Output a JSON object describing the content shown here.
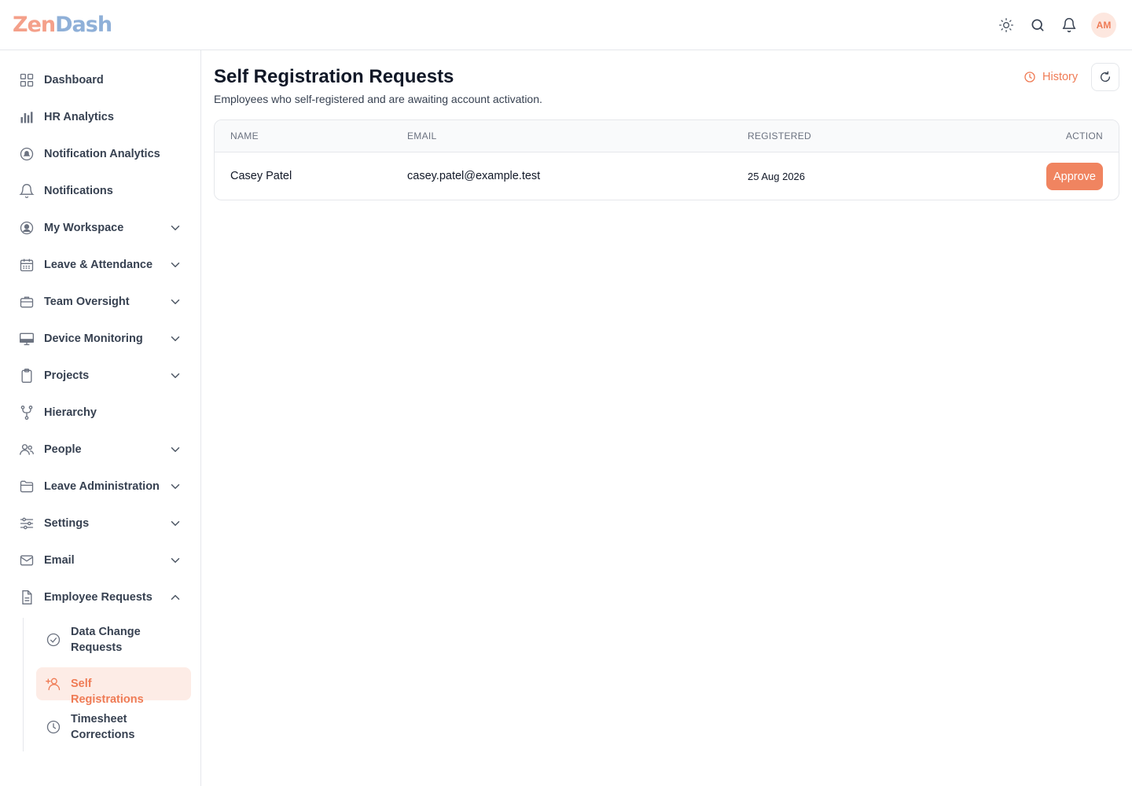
{
  "brand": {
    "logo_part1": "Zen",
    "logo_part2": "Dash"
  },
  "header": {
    "avatar_initials": "AM",
    "icons": [
      "sun-icon",
      "search-icon",
      "bell-icon"
    ]
  },
  "sidebar": {
    "items": [
      {
        "label": "Dashboard",
        "icon": "grid-icon",
        "expandable": false
      },
      {
        "label": "HR Analytics",
        "icon": "bar-chart-icon",
        "expandable": false
      },
      {
        "label": "Notification Analytics",
        "icon": "bell-circle-icon",
        "expandable": false
      },
      {
        "label": "Notifications",
        "icon": "bell-icon",
        "expandable": false
      },
      {
        "label": "My Workspace",
        "icon": "user-circle-icon",
        "expandable": true
      },
      {
        "label": "Leave & Attendance",
        "icon": "calendar-icon",
        "expandable": true
      },
      {
        "label": "Team Oversight",
        "icon": "briefcase-icon",
        "expandable": true
      },
      {
        "label": "Device Monitoring",
        "icon": "monitor-icon",
        "expandable": true
      },
      {
        "label": "Projects",
        "icon": "clipboard-icon",
        "expandable": true
      },
      {
        "label": "Hierarchy",
        "icon": "branch-icon",
        "expandable": false
      },
      {
        "label": "People",
        "icon": "users-icon",
        "expandable": true
      },
      {
        "label": "Leave Administration",
        "icon": "folder-icon",
        "expandable": true
      },
      {
        "label": "Settings",
        "icon": "sliders-icon",
        "expandable": true
      },
      {
        "label": "Email",
        "icon": "mail-icon",
        "expandable": true
      },
      {
        "label": "Employee Requests",
        "icon": "document-icon",
        "expandable": true,
        "expanded": true
      }
    ],
    "sub_items": [
      {
        "label": "Data Change Requests",
        "icon": "check-circle-icon"
      },
      {
        "label": "Self Registrations",
        "icon": "user-plus-icon",
        "active": true
      },
      {
        "label": "Timesheet Corrections",
        "icon": "clock-icon"
      }
    ]
  },
  "main": {
    "title": "Self Registration Requests",
    "subtitle": "Employees who self-registered and are awaiting account activation.",
    "history_label": "History",
    "accent_color": "#ef7b55",
    "table": {
      "columns": [
        "NAME",
        "EMAIL",
        "REGISTERED",
        "ACTION"
      ],
      "rows": [
        {
          "name": "Casey Patel",
          "email": "casey.patel@example.test",
          "registered": "25 Aug 2026",
          "action": "Approve"
        }
      ]
    }
  }
}
